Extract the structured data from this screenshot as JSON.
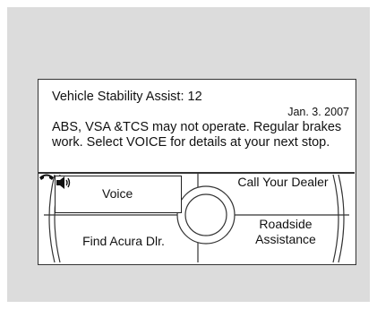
{
  "message": {
    "title": "Vehicle Stability Assist:  12",
    "date": "Jan. 3. 2007",
    "body": "ABS, VSA &TCS may not operate. Regular brakes work. Select VOICE for details at your next stop."
  },
  "controls": {
    "voice_label": "Voice",
    "find_dealer_label": "Find Acura Dlr.",
    "call_dealer_label": "Call Your Dealer",
    "roadside_label": "Roadside Assistance"
  },
  "icons": {
    "voice": "speaker-icon",
    "call": "phone-icon"
  }
}
